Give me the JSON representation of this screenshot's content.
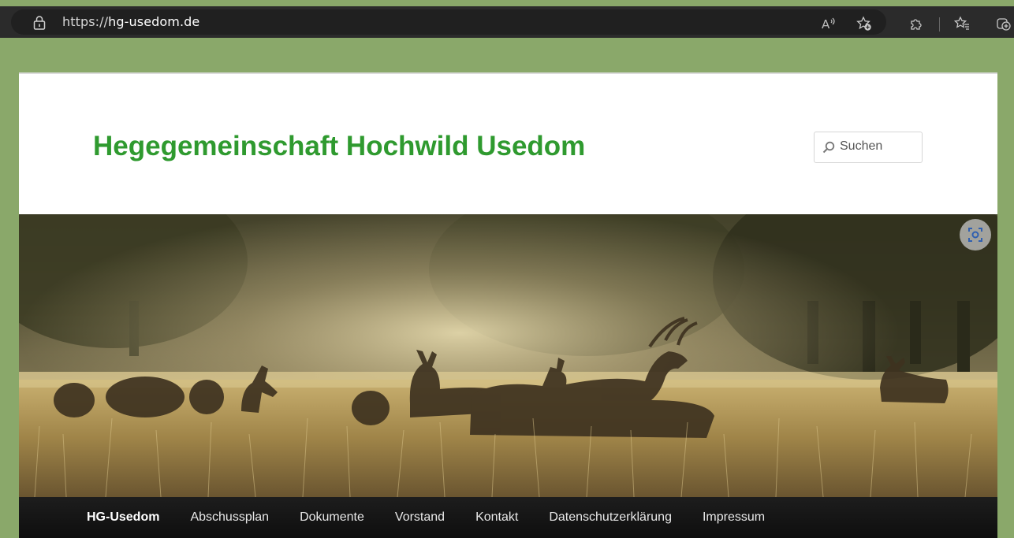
{
  "browser": {
    "url_scheme": "https://",
    "url_host": "hg-usedom.de"
  },
  "site": {
    "title": "Hegegemeinschaft Hochwild Usedom"
  },
  "search": {
    "placeholder": "Suchen"
  },
  "nav": {
    "items": [
      {
        "label": "HG-Usedom",
        "active": true
      },
      {
        "label": "Abschussplan"
      },
      {
        "label": "Dokumente"
      },
      {
        "label": "Vorstand"
      },
      {
        "label": "Kontakt"
      },
      {
        "label": "Datenschutzerklärung"
      },
      {
        "label": "Impressum"
      }
    ]
  },
  "colors": {
    "page_background": "#8aa86a",
    "title_green": "#2f9a2f",
    "nav_background": "#111111"
  },
  "icons": [
    "lock-icon",
    "read-aloud-icon",
    "add-favorite-icon",
    "extensions-icon",
    "favorites-icon",
    "collections-icon",
    "search-icon",
    "visual-search-icon"
  ]
}
